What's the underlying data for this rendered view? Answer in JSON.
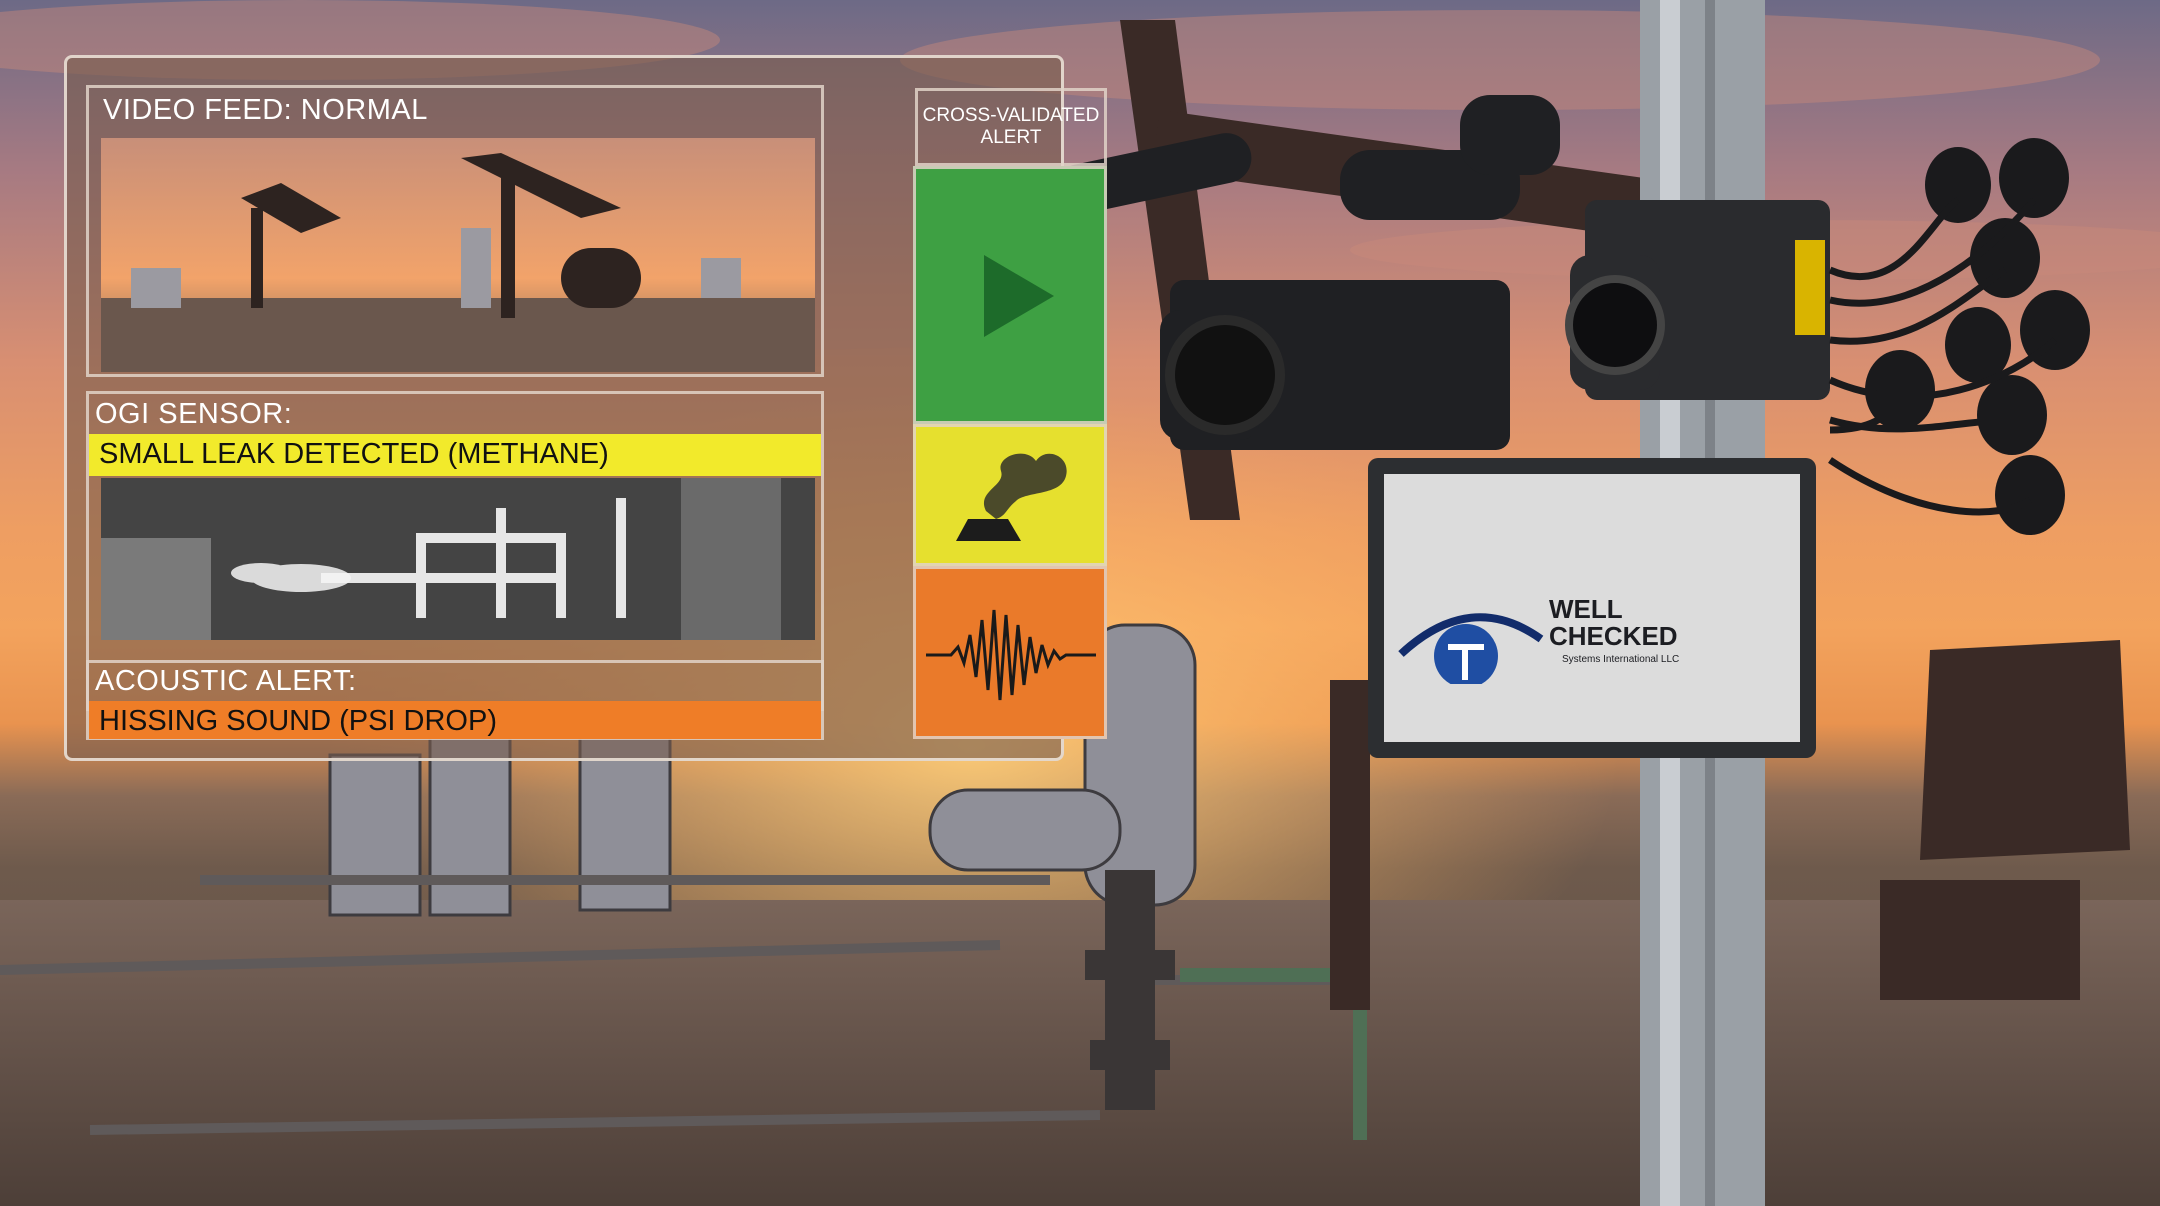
{
  "panel": {
    "video": {
      "title": "VIDEO FEED: NORMAL"
    },
    "ogi": {
      "title": "OGI SENSOR:",
      "alert": "SMALL LEAK DETECTED (METHANE)"
    },
    "acoustic": {
      "title": "ACOUSTIC ALERT:",
      "alert": "HISSING SOUND (PSI DROP)"
    },
    "cross": {
      "header_line1": "CROSS-VALIDATED",
      "header_line2": "ALERT"
    },
    "statuses": [
      {
        "name": "video-status",
        "color": "#3ea043",
        "icon": "play-icon"
      },
      {
        "name": "ogi-status",
        "color": "#e6e02e",
        "icon": "gas-leak-icon"
      },
      {
        "name": "acoustic-status",
        "color": "#ea7a2a",
        "icon": "soundwave-icon"
      }
    ]
  },
  "device": {
    "brand_line1": "WELL",
    "brand_line2": "CHECKED",
    "brand_sub": "Systems International LLC"
  },
  "colors": {
    "yellow_band": "#f2ea2b",
    "orange_band": "#ef7d27",
    "green": "#3ea043"
  }
}
